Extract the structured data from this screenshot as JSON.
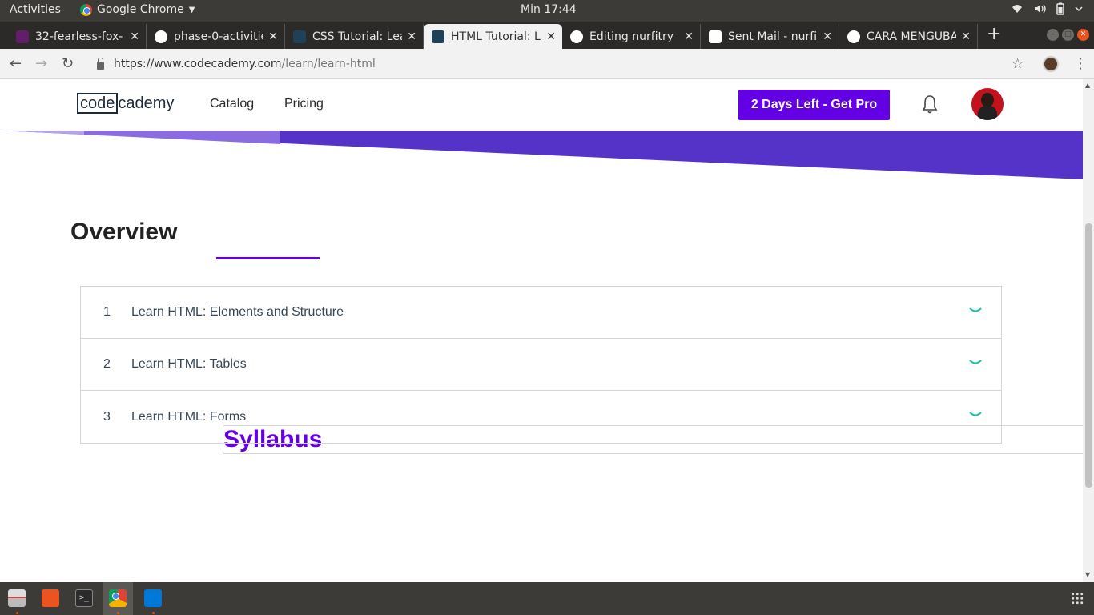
{
  "system": {
    "activities": "Activities",
    "app_name": "Google Chrome",
    "clock": "Min 17:44"
  },
  "browser": {
    "tabs": [
      {
        "title": "32-fearless-fox-",
        "favicon": "slack-icon",
        "active": false
      },
      {
        "title": "phase-0-activitie",
        "favicon": "github-icon",
        "active": false
      },
      {
        "title": "CSS Tutorial: Lea",
        "favicon": "codecademy-icon",
        "active": false
      },
      {
        "title": "HTML Tutorial: L",
        "favicon": "codecademy-icon",
        "active": true
      },
      {
        "title": "Editing nurfitry",
        "favicon": "github-icon",
        "active": false
      },
      {
        "title": "Sent Mail - nurfi",
        "favicon": "gmail-icon",
        "active": false
      },
      {
        "title": "CARA MENGUBA",
        "favicon": "google-icon",
        "active": false
      }
    ],
    "url_host": "https://www.codecademy.com",
    "url_path": "/learn/learn-html"
  },
  "site": {
    "logo_code": "code",
    "logo_cademy": "cademy",
    "nav": {
      "catalog": "Catalog",
      "pricing": "Pricing"
    },
    "pro_button": "2 Days Left - Get Pro"
  },
  "page": {
    "tabs": {
      "overview": "Overview",
      "syllabus": "Syllabus"
    },
    "syllabus": [
      {
        "number": "1",
        "title": "Learn HTML: Elements and Structure"
      },
      {
        "number": "2",
        "title": "Learn HTML: Tables"
      },
      {
        "number": "3",
        "title": "Learn HTML: Forms"
      }
    ]
  },
  "colors": {
    "brand_purple": "#6400e4",
    "banner_purple": "#5533c9",
    "chevron_teal": "#13c4a3",
    "ubuntu_orange": "#e95420"
  }
}
